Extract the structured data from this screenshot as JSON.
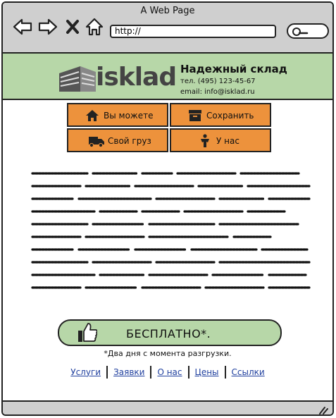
{
  "window": {
    "title": "A Web Page"
  },
  "browser": {
    "url": "http://"
  },
  "header": {
    "logo_text": "isklad",
    "company_name": "Надежный склад",
    "phone": "тел. (495) 123-45-67",
    "email": "email: info@isklad.ru"
  },
  "menu": {
    "items": [
      {
        "label": "Вы можете",
        "icon": "home-icon"
      },
      {
        "label": "Сохранить",
        "icon": "archive-box-icon"
      },
      {
        "label": "Свой груз",
        "icon": "truck-icon"
      },
      {
        "label": "У нас",
        "icon": "person-icon"
      }
    ]
  },
  "cta": {
    "label": "БЕСПЛАТНО*.",
    "icon": "thumbs-up-icon"
  },
  "note": "*Два дня с момента разгрузки.",
  "footer_links": [
    "Услуги",
    "Заявки",
    "О нас",
    "Цены",
    "Ссылки"
  ],
  "colors": {
    "header_bg": "#b7d7a8",
    "menu_bg": "#ed923c",
    "chrome_bg": "#cfcfcf",
    "link": "#1f3f9e"
  }
}
